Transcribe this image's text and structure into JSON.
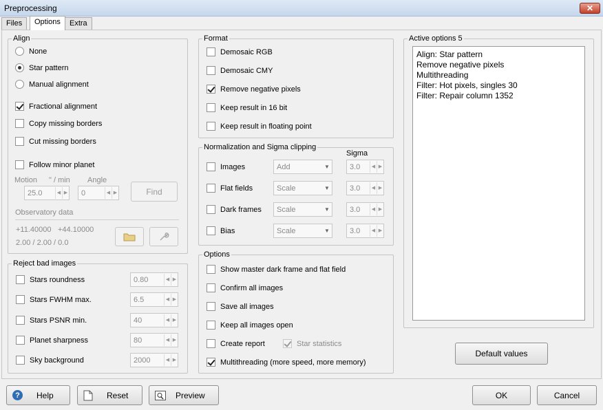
{
  "window": {
    "title": "Preprocessing",
    "close_glyph": "✕"
  },
  "tabs": [
    {
      "label": "Files"
    },
    {
      "label": "Options"
    },
    {
      "label": "Extra"
    }
  ],
  "align": {
    "title": "Align",
    "options": [
      "None",
      "Star pattern",
      "Manual alignment"
    ],
    "selected": "Star pattern",
    "fractional": "Fractional alignment",
    "copy_missing": "Copy missing borders",
    "cut_missing": "Cut missing borders",
    "follow_minor": "Follow minor planet",
    "motion_label": "Motion",
    "motion_unit": "\" / min",
    "angle_label": "Angle",
    "motion_value": "25.0",
    "angle_value": "0",
    "find_label": "Find",
    "observatory_label": "Observatory data",
    "obs_lat": "+11.40000",
    "obs_lon": "+44.10000",
    "obs_extra": "2.00 / 2.00 / 0.0"
  },
  "reject": {
    "title": "Reject bad images",
    "items": [
      {
        "label": "Stars roundness",
        "value": "0.80"
      },
      {
        "label": "Stars FWHM max.",
        "value": "6.5"
      },
      {
        "label": "Stars PSNR min.",
        "value": "40"
      },
      {
        "label": "Planet sharpness",
        "value": "80"
      },
      {
        "label": "Sky background",
        "value": "2000"
      }
    ]
  },
  "format": {
    "title": "Format",
    "items": [
      {
        "label": "Demosaic RGB",
        "checked": false
      },
      {
        "label": "Demosaic CMY",
        "checked": false
      },
      {
        "label": "Remove negative pixels",
        "checked": true
      },
      {
        "label": "Keep result in 16 bit",
        "checked": false
      },
      {
        "label": "Keep result in floating point",
        "checked": false
      }
    ]
  },
  "norm": {
    "title": "Normalization and Sigma clipping",
    "sigma_header": "Sigma",
    "rows": [
      {
        "label": "Images",
        "mode": "Add",
        "sigma": "3.0"
      },
      {
        "label": "Flat fields",
        "mode": "Scale",
        "sigma": "3.0"
      },
      {
        "label": "Dark frames",
        "mode": "Scale",
        "sigma": "3.0"
      },
      {
        "label": "Bias",
        "mode": "Scale",
        "sigma": "3.0"
      }
    ]
  },
  "options": {
    "title": "Options",
    "items": [
      {
        "label": "Show master dark frame and flat field",
        "checked": false
      },
      {
        "label": "Confirm all images",
        "checked": false
      },
      {
        "label": "Save all images",
        "checked": false
      },
      {
        "label": "Keep all images open",
        "checked": false
      },
      {
        "label": "Create report",
        "checked": false
      },
      {
        "label": "Multithreading (more speed, more memory)",
        "checked": true
      }
    ],
    "star_statistics": "Star statistics"
  },
  "active": {
    "title": "Active options 5",
    "lines": [
      "Align:  Star pattern",
      "Remove negative pixels",
      "Multithreading",
      "Filter:  Hot pixels, singles  30",
      "Filter:  Repair column  1352"
    ],
    "default_values": "Default values"
  },
  "footer": {
    "help": "Help",
    "reset": "Reset",
    "preview": "Preview",
    "ok": "OK",
    "cancel": "Cancel"
  },
  "colors": {
    "help_icon": "#2f6db4",
    "accent": "#3c7fb1"
  }
}
